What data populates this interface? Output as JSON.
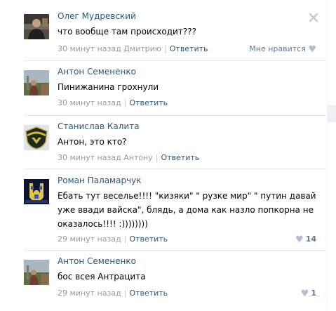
{
  "comments": [
    {
      "author": "Олег Мудревский",
      "text": "что вообще там происходит???",
      "time": "30 минут назад",
      "reply_to": "Дмитрию",
      "reply_label": "Ответить",
      "like_label": "Мне нравится",
      "like_icon": "heart-icon",
      "delete_icon": "close-icon"
    },
    {
      "author": "Антон Семененко",
      "text": "Пинижанина грохнули",
      "time": "30 минут назад",
      "reply_label": "Ответить"
    },
    {
      "author": "Станислав Калита",
      "text": "Антон, это кто?",
      "time": "30 минут назад",
      "reply_to": "Антону",
      "reply_label": "Ответить"
    },
    {
      "author": "Роман Паламарчук",
      "text_lines": [
        "Ебать тут веселье!!!! \"кизяки\" \" рузке мир\" \" путин давай",
        "уже ввади вайска\", блядь, а дома как назло попкорна не",
        "оказалось!!!! :))))))))"
      ],
      "time": "29 минут назад",
      "reply_label": "Ответить",
      "likes": "14",
      "like_icon": "heart-icon"
    },
    {
      "author": "Антон Семененко",
      "text": "бос всея Антрацита",
      "time": "29 минут назад",
      "reply_label": "Ответить",
      "likes": "1",
      "like_icon": "heart-icon"
    }
  ],
  "colors": {
    "link": "#2b587a",
    "meta": "#999999",
    "divider": "#e7e8ec",
    "heart": "#b0bed0"
  }
}
